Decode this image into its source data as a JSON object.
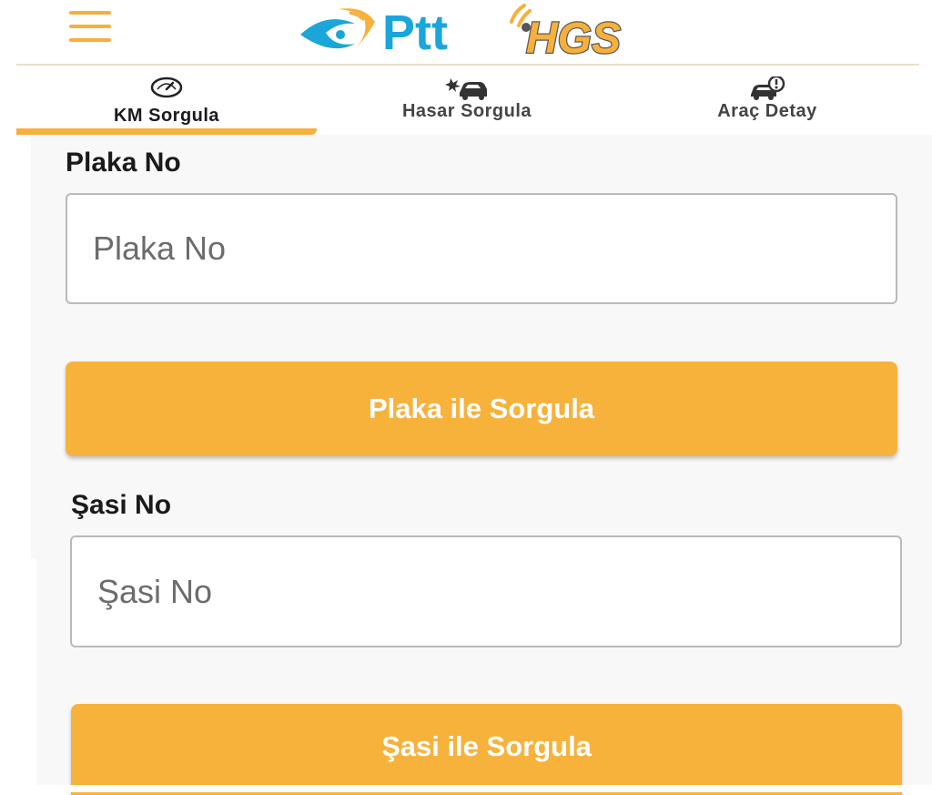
{
  "header": {
    "menu_icon": "hamburger-menu-icon",
    "logos": [
      {
        "name": "ptt-logo",
        "text": "Ptt",
        "color": "#1aa6d8"
      },
      {
        "name": "hgs-logo",
        "text": "HGS",
        "color": "#f6b03b"
      }
    ]
  },
  "tabs": [
    {
      "label": "KM Sorgula",
      "icon": "speedometer-icon",
      "active": true
    },
    {
      "label": "Hasar Sorgula",
      "icon": "car-crash-icon",
      "active": false
    },
    {
      "label": "Araç Detay",
      "icon": "car-info-icon",
      "active": false
    }
  ],
  "form": {
    "plaka": {
      "label": "Plaka No",
      "placeholder": "Plaka No",
      "value": "",
      "button_label": "Plaka ile Sorgula"
    },
    "sasi": {
      "label": "Şasi No",
      "placeholder": "Şasi No",
      "value": "",
      "button_label": "Şasi ile Sorgula"
    }
  },
  "colors": {
    "accent": "#f6b03b",
    "ptt_blue": "#1aa6d8",
    "text_dark": "#1a1a1a",
    "input_border": "#b9b9b9"
  }
}
